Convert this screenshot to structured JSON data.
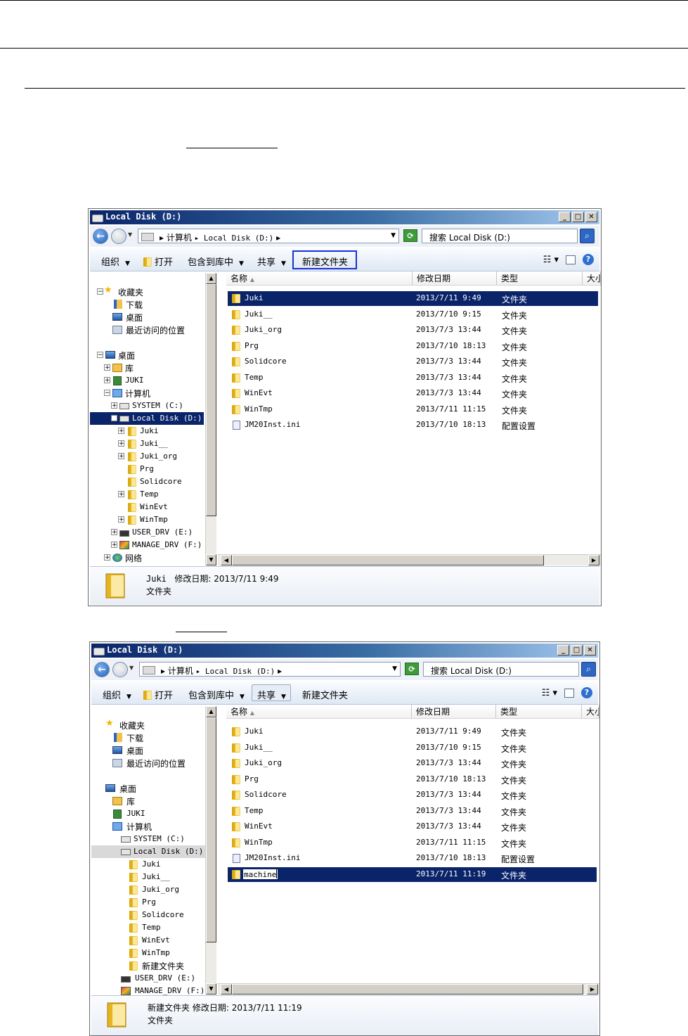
{
  "window1": {
    "title": "Local Disk (D:)",
    "nav": {
      "back": "←",
      "forward": "→"
    },
    "address": {
      "seg1": "▸ 计算机",
      "seg2": "▸ Local Disk (D:)",
      "seg3": "▸"
    },
    "search_placeholder": "搜索 Local Disk (D:)",
    "toolbar": {
      "organize": "组织",
      "open": "打开",
      "include": "包含到库中",
      "share": "共享",
      "newfolder": "新建文件夹"
    },
    "tree": [
      {
        "label": "收藏夹",
        "icon": "star-icon"
      },
      {
        "label": "下载",
        "icon": "downloads-icon"
      },
      {
        "label": "桌面",
        "icon": "desktop-icon"
      },
      {
        "label": "最近访问的位置",
        "icon": "recent-places-icon"
      },
      {
        "label": "桌面",
        "icon": "desktop-icon"
      },
      {
        "label": "库",
        "icon": "library-icon"
      },
      {
        "label": "JUKI",
        "icon": "juki-icon"
      },
      {
        "label": "计算机",
        "icon": "computer-icon"
      },
      {
        "label": "SYSTEM (C:)",
        "icon": "system-drive-icon"
      },
      {
        "label": "Local Disk (D:)",
        "icon": "drive-icon"
      },
      {
        "label": "Juki",
        "icon": "folder-icon"
      },
      {
        "label": "Juki__",
        "icon": "folder-icon"
      },
      {
        "label": "Juki_org",
        "icon": "folder-icon"
      },
      {
        "label": "Prg",
        "icon": "folder-icon"
      },
      {
        "label": "Solidcore",
        "icon": "folder-icon"
      },
      {
        "label": "Temp",
        "icon": "folder-icon"
      },
      {
        "label": "WinEvt",
        "icon": "folder-icon"
      },
      {
        "label": "WinTmp",
        "icon": "folder-icon"
      },
      {
        "label": "USER_DRV (E:)",
        "icon": "usb-drive-icon"
      },
      {
        "label": "MANAGE_DRV (F:)",
        "icon": "manage-drive-icon"
      },
      {
        "label": "网络",
        "icon": "network-icon"
      }
    ],
    "columns": {
      "name": "名称",
      "date": "修改日期",
      "type": "类型",
      "size": "大小"
    },
    "files": [
      {
        "name": "Juki",
        "date": "2013/7/11 9:49",
        "type": "文件夹"
      },
      {
        "name": "Juki__",
        "date": "2013/7/10 9:15",
        "type": "文件夹"
      },
      {
        "name": "Juki_org",
        "date": "2013/7/3 13:44",
        "type": "文件夹"
      },
      {
        "name": "Prg",
        "date": "2013/7/10 18:13",
        "type": "文件夹"
      },
      {
        "name": "Solidcore",
        "date": "2013/7/3 13:44",
        "type": "文件夹"
      },
      {
        "name": "Temp",
        "date": "2013/7/3 13:44",
        "type": "文件夹"
      },
      {
        "name": "WinEvt",
        "date": "2013/7/3 13:44",
        "type": "文件夹"
      },
      {
        "name": "WinTmp",
        "date": "2013/7/11 11:15",
        "type": "文件夹"
      },
      {
        "name": "JM20Inst.ini",
        "date": "2013/7/10 18:13",
        "type": "配置设置"
      }
    ],
    "details": {
      "name": "Juki",
      "modified_label": "修改日期:",
      "modified": "2013/7/11 9:49",
      "type": "文件夹"
    }
  },
  "window2": {
    "title": "Local Disk (D:)",
    "address": {
      "seg1": "▸ 计算机",
      "seg2": "▸ Local Disk (D:)",
      "seg3": "▸"
    },
    "search_placeholder": "搜索 Local Disk (D:)",
    "toolbar": {
      "organize": "组织",
      "open": "打开",
      "include": "包含到库中",
      "share": "共享",
      "newfolder": "新建文件夹"
    },
    "tree": [
      {
        "label": "收藏夹"
      },
      {
        "label": "下载"
      },
      {
        "label": "桌面"
      },
      {
        "label": "最近访问的位置"
      },
      {
        "label": "桌面"
      },
      {
        "label": "库"
      },
      {
        "label": "JUKI"
      },
      {
        "label": "计算机"
      },
      {
        "label": "SYSTEM (C:)"
      },
      {
        "label": "Local Disk (D:)"
      },
      {
        "label": "Juki"
      },
      {
        "label": "Juki__"
      },
      {
        "label": "Juki_org"
      },
      {
        "label": "Prg"
      },
      {
        "label": "Solidcore"
      },
      {
        "label": "Temp"
      },
      {
        "label": "WinEvt"
      },
      {
        "label": "WinTmp"
      },
      {
        "label": "新建文件夹"
      },
      {
        "label": "USER_DRV (E:)"
      },
      {
        "label": "MANAGE_DRV (F:)"
      }
    ],
    "columns": {
      "name": "名称",
      "date": "修改日期",
      "type": "类型",
      "size": "大小"
    },
    "files": [
      {
        "name": "Juki",
        "date": "2013/7/11 9:49",
        "type": "文件夹"
      },
      {
        "name": "Juki__",
        "date": "2013/7/10 9:15",
        "type": "文件夹"
      },
      {
        "name": "Juki_org",
        "date": "2013/7/3 13:44",
        "type": "文件夹"
      },
      {
        "name": "Prg",
        "date": "2013/7/10 18:13",
        "type": "文件夹"
      },
      {
        "name": "Solidcore",
        "date": "2013/7/3 13:44",
        "type": "文件夹"
      },
      {
        "name": "Temp",
        "date": "2013/7/3 13:44",
        "type": "文件夹"
      },
      {
        "name": "WinEvt",
        "date": "2013/7/3 13:44",
        "type": "文件夹"
      },
      {
        "name": "WinTmp",
        "date": "2013/7/11 11:15",
        "type": "文件夹"
      },
      {
        "name": "JM20Inst.ini",
        "date": "2013/7/10 18:13",
        "type": "配置设置"
      },
      {
        "name": "machine",
        "date": "2013/7/11 11:19",
        "type": "文件夹"
      }
    ],
    "details": {
      "name": "新建文件夹",
      "modified_label": "修改日期:",
      "modified": "2013/7/11 11:19",
      "type": "文件夹"
    }
  }
}
